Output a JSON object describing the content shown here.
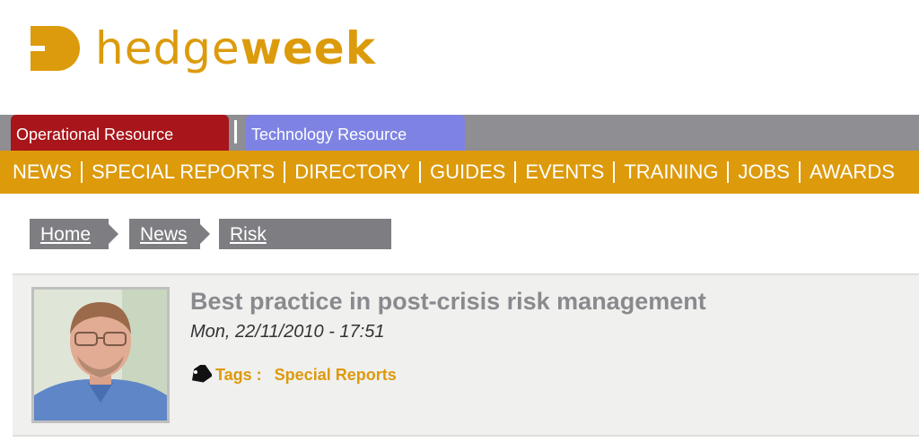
{
  "logo": {
    "text_light": "hedge",
    "text_bold": "week",
    "color": "#dc9b0c"
  },
  "resource_centres": [
    {
      "label": "Operational Resource Centre",
      "color": "#a8151a"
    },
    {
      "label": "Technology Resource Centre",
      "color": "#7e83e3"
    }
  ],
  "main_nav": [
    "NEWS",
    "SPECIAL REPORTS",
    "DIRECTORY",
    "GUIDES",
    "EVENTS",
    "TRAINING",
    "JOBS",
    "AWARDS"
  ],
  "breadcrumb": [
    "Home",
    "News",
    "Risk Management"
  ],
  "article": {
    "title": "Best practice in post-crisis risk management",
    "date": "Mon, 22/11/2010 - 17:51",
    "tags_label": "Tags :",
    "tag": "Special Reports"
  },
  "colors": {
    "accent": "#dd9a0b",
    "nav_bar": "#8e8e93",
    "breadcrumb_bg": "#7d7d82"
  }
}
